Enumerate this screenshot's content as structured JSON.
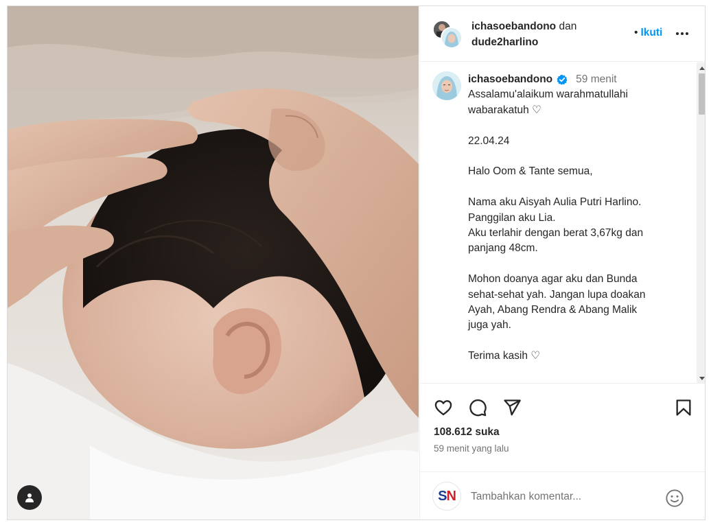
{
  "post": {
    "image_alt": "newborn baby head cradled by hands"
  },
  "header": {
    "user1": "ichasoebandono",
    "conjunction": "dan",
    "user2": "dude2harlino",
    "follow_dot": "•",
    "follow_label": "Ikuti"
  },
  "caption": {
    "username": "ichasoebandono",
    "time": "59 menit",
    "lines": [
      "Assalamu'alaikum warahmatullahi",
      "wabarakatuh ♡",
      "",
      "22.04.24",
      "",
      "Halo Oom & Tante semua,",
      "",
      "Nama aku Aisyah Aulia Putri Harlino.",
      "Panggilan aku Lia.",
      "Aku terlahir dengan berat 3,67kg dan",
      "panjang 48cm.",
      "",
      "Mohon doanya agar aku dan Bunda",
      "sehat-sehat yah. Jangan lupa doakan",
      "Ayah, Abang Rendra & Abang Malik",
      "juga yah.",
      "",
      "Terima kasih ♡"
    ]
  },
  "stats": {
    "likes": "108.612 suka",
    "posted_ago": "59 menit yang lalu"
  },
  "comment": {
    "logo_s": "S",
    "logo_n": "N",
    "placeholder": "Tambahkan komentar..."
  },
  "icons": {
    "like": "heart-icon",
    "comment": "comment-bubble-icon",
    "share": "paper-plane-icon",
    "save": "bookmark-icon",
    "verified": "verified-badge-icon",
    "more": "more-options-icon",
    "emoji": "emoji-icon",
    "user_tag": "user-tag-icon"
  },
  "colors": {
    "accent": "#0095f6",
    "verified": "#0095f6",
    "text_primary": "#262626",
    "text_secondary": "#737373",
    "divider": "#efefef"
  }
}
